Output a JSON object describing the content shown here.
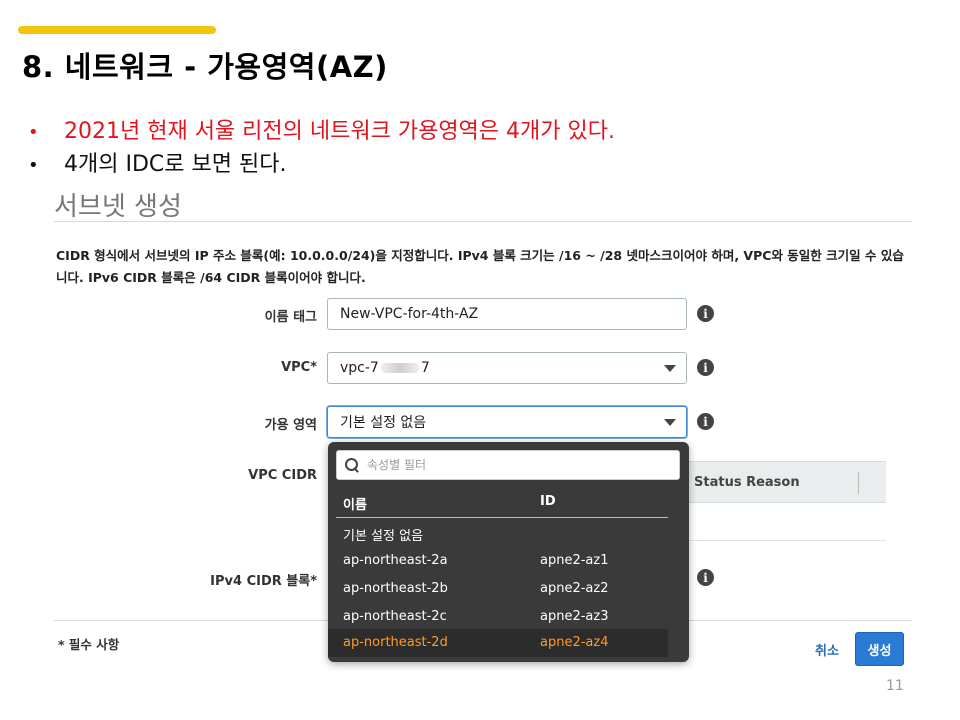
{
  "slide": {
    "title": "8. 네트워크 - 가용영역(AZ)",
    "bullets": [
      "2021년 현재 서울 리전의 네트워크 가용영역은 4개가 있다.",
      "4개의 IDC로 보면 된다."
    ],
    "bullet_symbol": "•",
    "page_number": "11",
    "colors": {
      "accent": "#f5c20f",
      "bullet_red": "#e3141e"
    }
  },
  "screenshot": {
    "title": "서브넷 생성",
    "description": "CIDR 형식에서 서브넷의 IP 주소 블록(예: 10.0.0.0/24)을 지정합니다. IPv4 블록 크기는 /16 ~ /28 넷마스크이어야 하며, VPC와 동일한 크기일 수 있습니다. IPv6 CIDR 블록은 /64 CIDR 블록이어야 합니다.",
    "fields": {
      "name_tag": {
        "label": "이름 태그",
        "value": "New-VPC-for-4th-AZ"
      },
      "vpc": {
        "label": "VPC*",
        "value_prefix": "vpc-7",
        "value_suffix": "7"
      },
      "availability_zone": {
        "label": "가용 영역",
        "value": "기본 설정 없음"
      },
      "vpc_cidr": {
        "label": "VPC CIDR"
      },
      "ipv4_cidr": {
        "label": "IPv4 CIDR 블록*"
      }
    },
    "info_icon_glyph": "i",
    "background_table": {
      "column": "Status Reason"
    },
    "required_note": "* 필수 사항",
    "cancel_label": "취소",
    "create_label": "생성",
    "dropdown": {
      "search_placeholder": "속성별 필터",
      "headers": {
        "name": "이름",
        "id": "ID"
      },
      "default_option": "기본 설정 없음",
      "options": [
        {
          "name": "ap-northeast-2a",
          "id": "apne2-az1"
        },
        {
          "name": "ap-northeast-2b",
          "id": "apne2-az2"
        },
        {
          "name": "ap-northeast-2c",
          "id": "apne2-az3"
        },
        {
          "name": "ap-northeast-2d",
          "id": "apne2-az4",
          "selected": true
        }
      ]
    }
  }
}
